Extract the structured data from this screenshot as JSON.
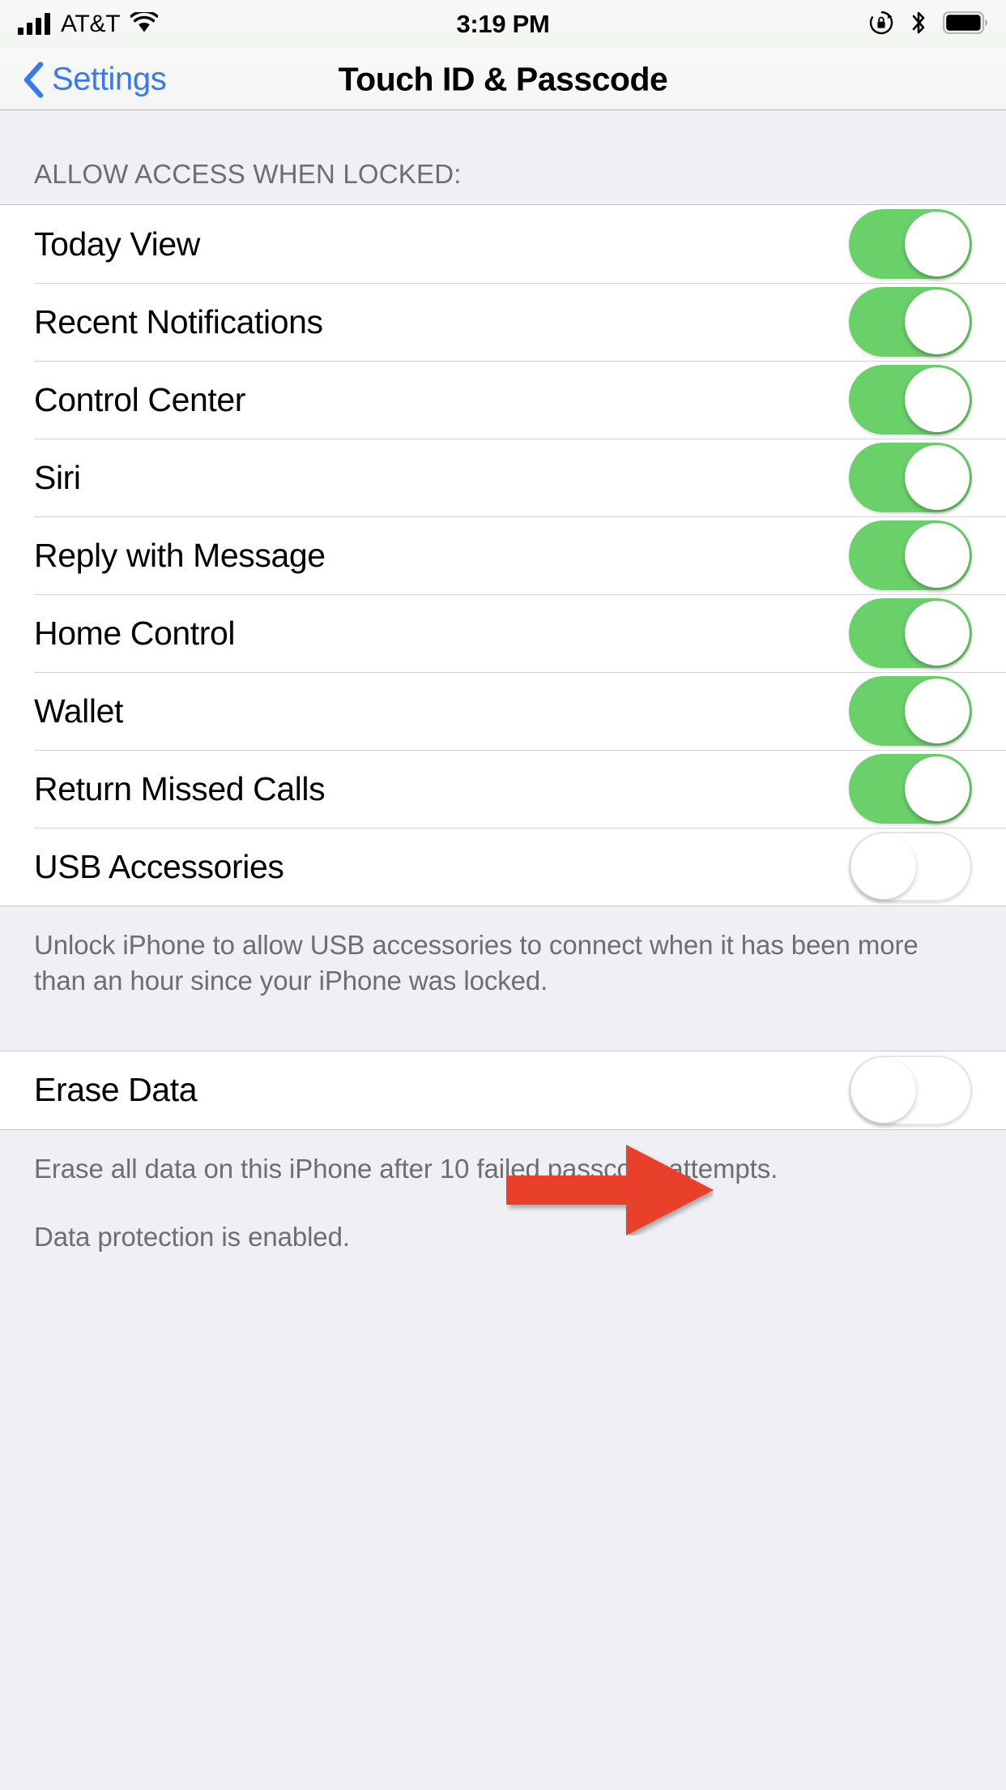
{
  "status_bar": {
    "carrier": "AT&T",
    "time": "3:19 PM",
    "signal_icon": "cellular-bars-icon",
    "wifi_icon": "wifi-icon",
    "rotation_lock_icon": "rotation-lock-icon",
    "bluetooth_icon": "bluetooth-icon",
    "battery_icon": "battery-full-icon"
  },
  "nav": {
    "back_label": "Settings",
    "back_icon": "chevron-left-icon",
    "title": "Touch ID & Passcode"
  },
  "section": {
    "header": "ALLOW ACCESS WHEN LOCKED:",
    "rows": [
      {
        "label": "Today View",
        "toggle": "on"
      },
      {
        "label": "Recent Notifications",
        "toggle": "on"
      },
      {
        "label": "Control Center",
        "toggle": "on"
      },
      {
        "label": "Siri",
        "toggle": "on"
      },
      {
        "label": "Reply with Message",
        "toggle": "on"
      },
      {
        "label": "Home Control",
        "toggle": "on"
      },
      {
        "label": "Wallet",
        "toggle": "on"
      },
      {
        "label": "Return Missed Calls",
        "toggle": "on"
      },
      {
        "label": "USB Accessories",
        "toggle": "off"
      }
    ],
    "footer": "Unlock iPhone to allow USB accessories to connect when it has been more than an hour since your iPhone was locked."
  },
  "erase_section": {
    "rows": [
      {
        "label": "Erase Data",
        "toggle": "off"
      }
    ],
    "footer_line_1": "Erase all data on this iPhone after 10 failed passcode attempts.",
    "footer_line_2": "Data protection is enabled."
  },
  "annotation": {
    "arrow_icon": "red-arrow-right-icon",
    "color": "#e8412a",
    "points_to": "USB Accessories"
  },
  "colors": {
    "toggle_on": "#6ad16a",
    "accent_blue": "#3979f0",
    "group_background": "#ffffff",
    "page_background": "#efeff4",
    "secondary_text": "#6d6d72"
  }
}
